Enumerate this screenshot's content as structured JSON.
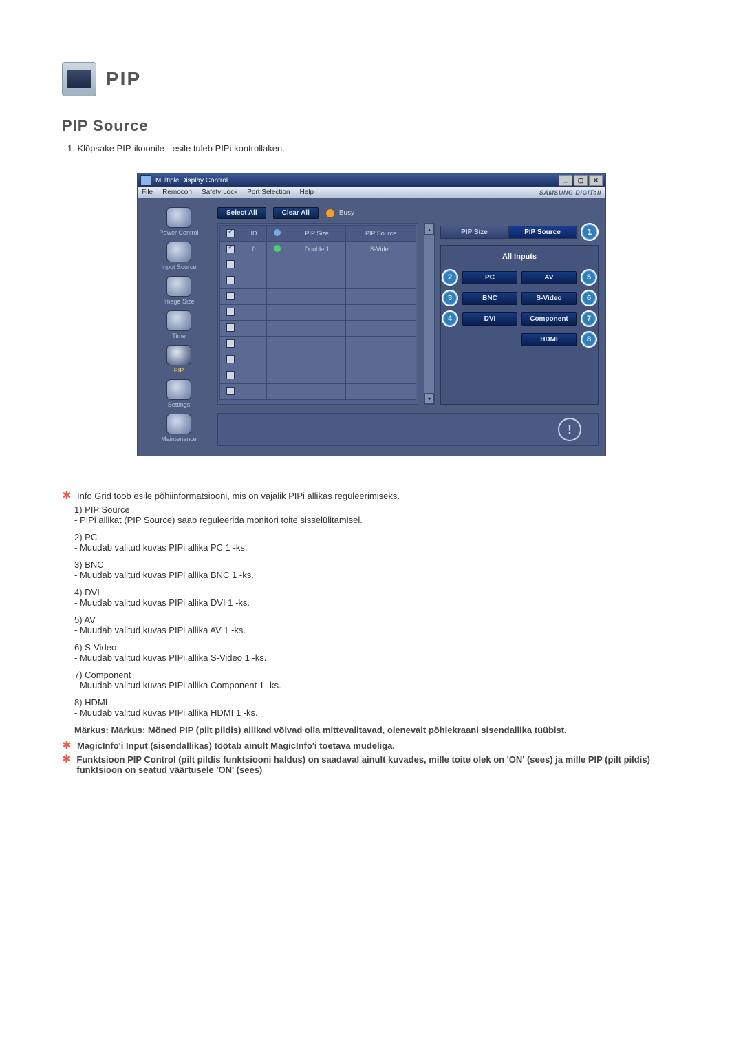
{
  "header": {
    "title": "PIP",
    "section_title": "PIP Source",
    "intro": "1. Klõpsake PIP-ikoonile - esile tuleb PIPi kontrollaken."
  },
  "window": {
    "title": "Multiple Display Control",
    "menubar": [
      "File",
      "Remocon",
      "Safety Lock",
      "Port Selection",
      "Help"
    ],
    "brand": "SAMSUNG DIGITall",
    "toolbar": {
      "select_all": "Select All",
      "clear_all": "Clear All",
      "busy": "Busy"
    },
    "sidebar": [
      {
        "label": "Power Control",
        "active": false
      },
      {
        "label": "Input Source",
        "active": false
      },
      {
        "label": "Image Size",
        "active": false
      },
      {
        "label": "Time",
        "active": false
      },
      {
        "label": "PIP",
        "active": true
      },
      {
        "label": "Settings",
        "active": false
      },
      {
        "label": "Maintenance",
        "active": false
      }
    ],
    "grid": {
      "columns": [
        "",
        "ID",
        "",
        "PIP Size",
        "PIP Source"
      ],
      "rows": [
        {
          "checked": true,
          "id": "0",
          "led": "green",
          "pip_size": "Double 1",
          "pip_source": "S-Video"
        },
        {
          "checked": false,
          "id": "",
          "led": "",
          "pip_size": "",
          "pip_source": ""
        },
        {
          "checked": false,
          "id": "",
          "led": "",
          "pip_size": "",
          "pip_source": ""
        },
        {
          "checked": false,
          "id": "",
          "led": "",
          "pip_size": "",
          "pip_source": ""
        },
        {
          "checked": false,
          "id": "",
          "led": "",
          "pip_size": "",
          "pip_source": ""
        },
        {
          "checked": false,
          "id": "",
          "led": "",
          "pip_size": "",
          "pip_source": ""
        },
        {
          "checked": false,
          "id": "",
          "led": "",
          "pip_size": "",
          "pip_source": ""
        },
        {
          "checked": false,
          "id": "",
          "led": "",
          "pip_size": "",
          "pip_source": ""
        },
        {
          "checked": false,
          "id": "",
          "led": "",
          "pip_size": "",
          "pip_source": ""
        },
        {
          "checked": false,
          "id": "",
          "led": "",
          "pip_size": "",
          "pip_source": ""
        }
      ]
    },
    "right_pane": {
      "tabs": [
        {
          "label": "PIP Size",
          "active": false
        },
        {
          "label": "PIP Source",
          "active": true
        }
      ],
      "header": "All Inputs",
      "callout_top": "1",
      "buttons_left": [
        {
          "callout": "2",
          "label": "PC"
        },
        {
          "callout": "3",
          "label": "BNC"
        },
        {
          "callout": "4",
          "label": "DVI"
        }
      ],
      "buttons_right": [
        {
          "callout": "5",
          "label": "AV"
        },
        {
          "callout": "6",
          "label": "S-Video"
        },
        {
          "callout": "7",
          "label": "Component"
        },
        {
          "callout": "8",
          "label": "HDMI"
        }
      ]
    }
  },
  "notes": {
    "star1": "Info Grid toob esile põhiinformatsiooni, mis on vajalik PIPi allikas reguleerimiseks.",
    "items": [
      {
        "num": "1)",
        "label": "PIP Source",
        "desc": "- PIPi allikat (PIP Source) saab reguleerida monitori toite sisselülitamisel."
      },
      {
        "num": "2)",
        "label": "PC",
        "desc": "- Muudab valitud kuvas PIPi allika PC 1 -ks."
      },
      {
        "num": "3)",
        "label": "BNC",
        "desc": "- Muudab valitud kuvas PIPi allika BNC 1 -ks."
      },
      {
        "num": "4)",
        "label": "DVI",
        "desc": "- Muudab valitud kuvas PIPi allika DVI 1 -ks."
      },
      {
        "num": "5)",
        "label": "AV",
        "desc": "- Muudab valitud kuvas PIPi allika AV 1 -ks."
      },
      {
        "num": "6)",
        "label": "S-Video",
        "desc": "- Muudab valitud kuvas PIPi allika S-Video 1 -ks."
      },
      {
        "num": "7)",
        "label": "Component",
        "desc": "- Muudab valitud kuvas PIPi allika Component 1 -ks."
      },
      {
        "num": "8)",
        "label": "HDMI",
        "desc": "- Muudab valitud kuvas PIPi allika HDMI 1 -ks."
      }
    ],
    "remark": "Märkus: Märkus: Mõned PIP (pilt pildis) allikad võivad olla mittevalitavad, olenevalt põhiekraani sisendallika tüübist.",
    "star2": "MagicInfo'i Input (sisendallikas) töötab ainult MagicInfo'i toetava mudeliga.",
    "star3": "Funktsioon PIP Control (pilt pildis funktsiooni haldus) on saadaval ainult kuvades, mille toite olek on 'ON' (sees) ja mille PIP (pilt pildis) funktsioon on seatud väärtusele 'ON' (sees)"
  }
}
